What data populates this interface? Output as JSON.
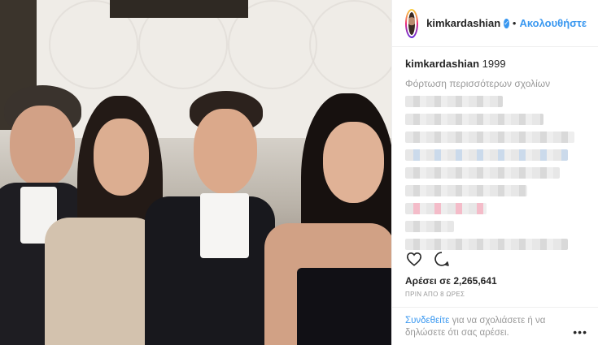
{
  "header": {
    "username": "kimkardashian",
    "separator": "•",
    "follow_label": "Ακολουθήστε",
    "verified_icon": "verified-badge-icon"
  },
  "caption": {
    "username": "kimkardashian",
    "text": "1999"
  },
  "load_more_label": "Φόρτωση περισσότερων σχολίων",
  "actions": {
    "like_icon": "heart-icon",
    "comment_icon": "comment-icon"
  },
  "likes_label": "Αρέσει σε 2,265,641",
  "timestamp": "ΠΡΙΝ ΑΠΟ 8 ΩΡΕΣ",
  "footer": {
    "login_link": "Συνδεθείτε",
    "login_text": " για να σχολιάσετε ή να δηλώσετε ότι σας αρέσει.",
    "more_label": "•••"
  },
  "colors": {
    "link": "#3897f0",
    "muted": "#999999",
    "text": "#262626"
  }
}
